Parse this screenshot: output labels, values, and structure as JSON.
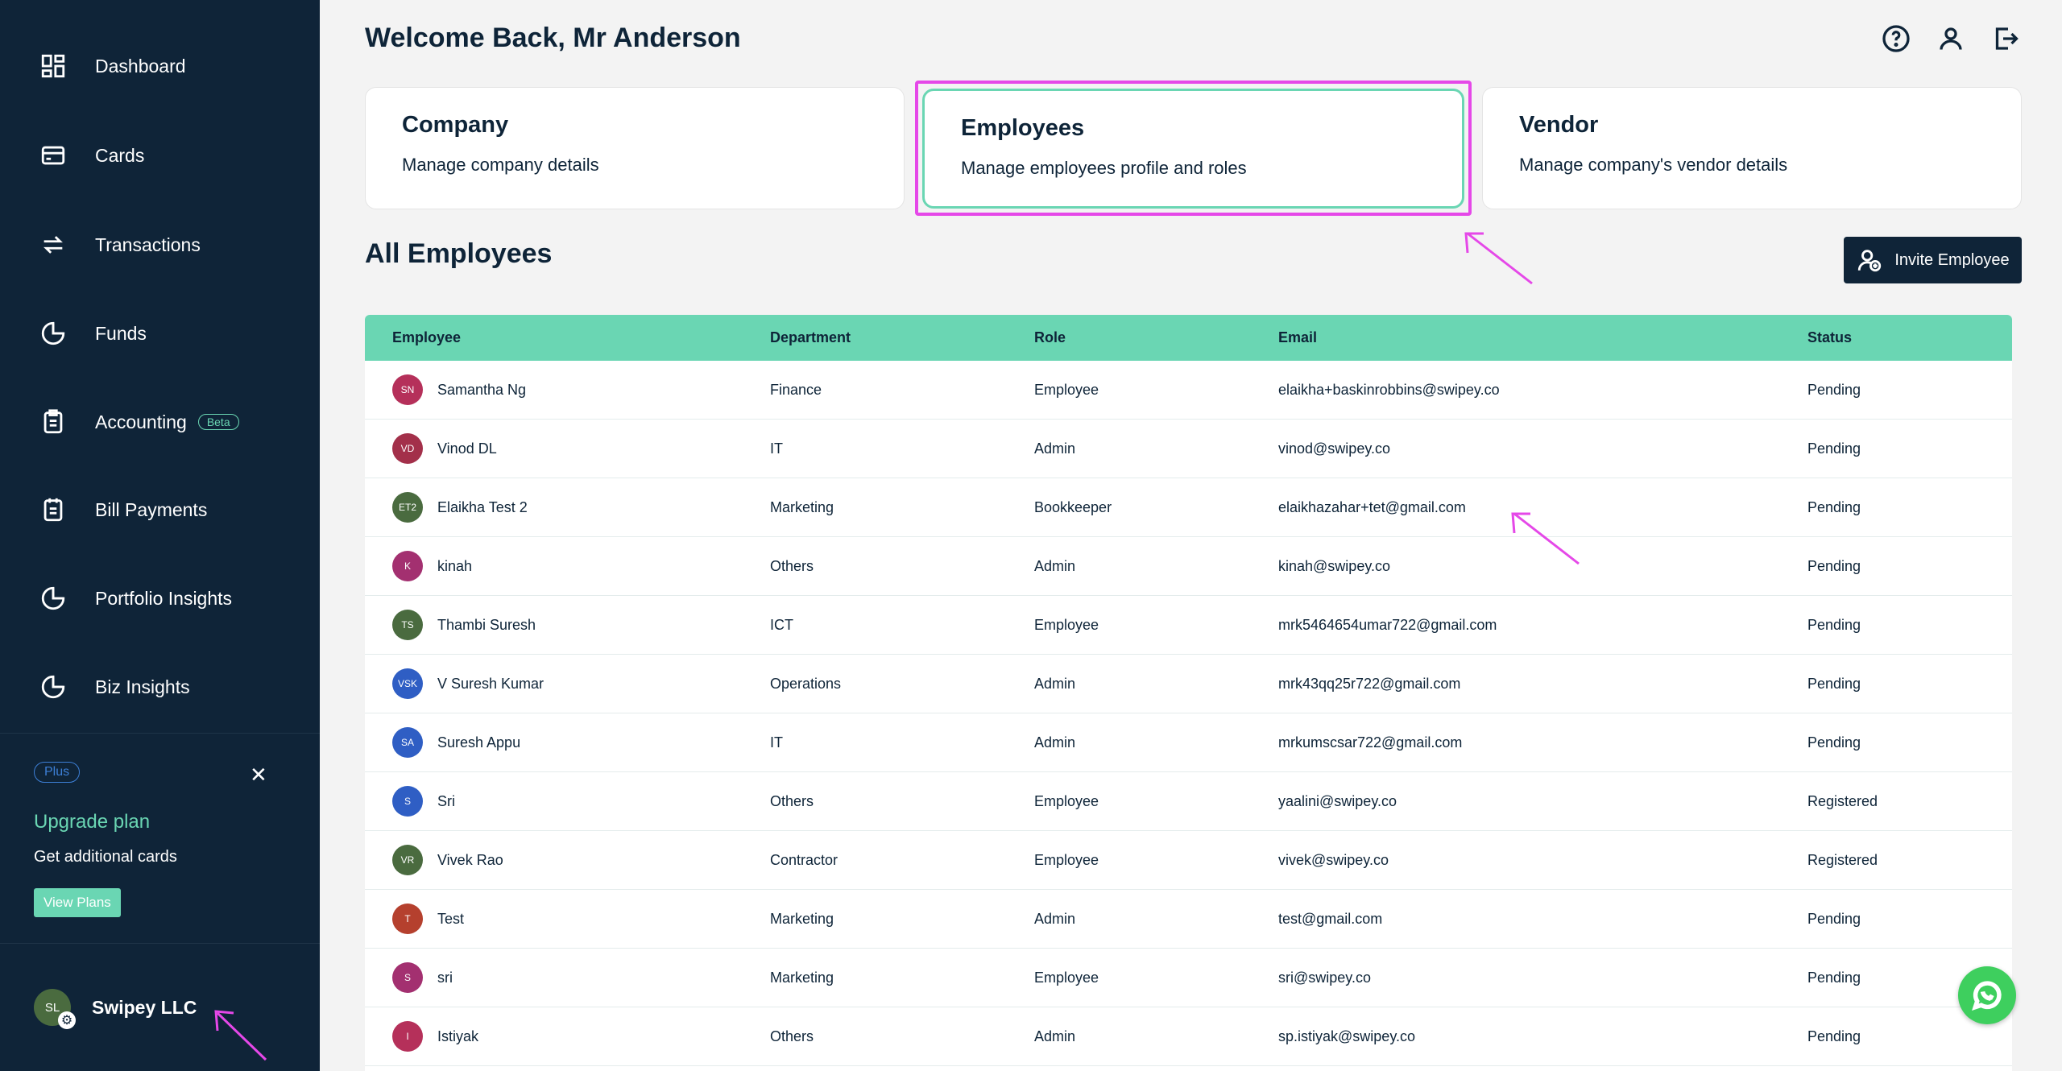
{
  "sidebar": {
    "items": [
      {
        "label": "Dashboard",
        "icon": "dashboard-icon"
      },
      {
        "label": "Cards",
        "icon": "card-icon"
      },
      {
        "label": "Transactions",
        "icon": "transactions-icon"
      },
      {
        "label": "Funds",
        "icon": "pie-chart-icon"
      },
      {
        "label": "Accounting",
        "icon": "clipboard-icon",
        "badge": "Beta"
      },
      {
        "label": "Bill Payments",
        "icon": "bill-icon"
      },
      {
        "label": "Portfolio Insights",
        "icon": "pie-chart-icon"
      },
      {
        "label": "Biz Insights",
        "icon": "pie-chart-icon"
      }
    ],
    "upgrade": {
      "badge": "Plus",
      "close": "✕",
      "title": "Upgrade plan",
      "subtitle": "Get additional cards",
      "button": "View Plans"
    },
    "company": {
      "initials": "SL",
      "name": "Swipey LLC"
    }
  },
  "header": {
    "welcome": "Welcome Back, Mr Anderson"
  },
  "cards": [
    {
      "title": "Company",
      "subtitle": "Manage company details"
    },
    {
      "title": "Employees",
      "subtitle": "Manage employees profile and roles"
    },
    {
      "title": "Vendor",
      "subtitle": "Manage company's vendor details"
    }
  ],
  "section": {
    "title": "All Employees",
    "invite_label": "Invite Employee"
  },
  "table": {
    "headers": [
      "Employee",
      "Department",
      "Role",
      "Email",
      "Status"
    ],
    "rows": [
      {
        "initials": "SN",
        "color": "#b5305a",
        "name": "Samantha Ng",
        "dept": "Finance",
        "role": "Employee",
        "email": "elaikha+baskinrobbins@swipey.co",
        "status": "Pending"
      },
      {
        "initials": "VD",
        "color": "#a3304a",
        "name": "Vinod DL",
        "dept": "IT",
        "role": "Admin",
        "email": "vinod@swipey.co",
        "status": "Pending"
      },
      {
        "initials": "ET2",
        "color": "#4a6b3f",
        "name": "Elaikha Test 2",
        "dept": "Marketing",
        "role": "Bookkeeper",
        "email": "elaikhazahar+tet@gmail.com",
        "status": "Pending"
      },
      {
        "initials": "K",
        "color": "#a33070",
        "name": "kinah",
        "dept": "Others",
        "role": "Admin",
        "email": "kinah@swipey.co",
        "status": "Pending"
      },
      {
        "initials": "TS",
        "color": "#4a6b3f",
        "name": "Thambi Suresh",
        "dept": "ICT",
        "role": "Employee",
        "email": "mrk5464654umar722@gmail.com",
        "status": "Pending"
      },
      {
        "initials": "VSK",
        "color": "#2f5ec4",
        "name": "V Suresh Kumar",
        "dept": "Operations",
        "role": "Admin",
        "email": "mrk43qq25r722@gmail.com",
        "status": "Pending"
      },
      {
        "initials": "SA",
        "color": "#2f5ec4",
        "name": "Suresh Appu",
        "dept": "IT",
        "role": "Admin",
        "email": "mrkumscsar722@gmail.com",
        "status": "Pending"
      },
      {
        "initials": "S",
        "color": "#2f5ec4",
        "name": "Sri",
        "dept": "Others",
        "role": "Employee",
        "email": "yaalini@swipey.co",
        "status": "Registered"
      },
      {
        "initials": "VR",
        "color": "#4a6b3f",
        "name": "Vivek Rao",
        "dept": "Contractor",
        "role": "Employee",
        "email": "vivek@swipey.co",
        "status": "Registered"
      },
      {
        "initials": "T",
        "color": "#b5402e",
        "name": "Test",
        "dept": "Marketing",
        "role": "Admin",
        "email": "test@gmail.com",
        "status": "Pending"
      },
      {
        "initials": "S",
        "color": "#a33070",
        "name": "sri",
        "dept": "Marketing",
        "role": "Employee",
        "email": "sri@swipey.co",
        "status": "Pending"
      },
      {
        "initials": "I",
        "color": "#b5305a",
        "name": "Istiyak",
        "dept": "Others",
        "role": "Admin",
        "email": "sp.istiyak@swipey.co",
        "status": "Pending"
      }
    ]
  },
  "colors": {
    "sidebar": "#0f2438",
    "accent": "#6ad6b3",
    "annotation": "#e548e8"
  }
}
